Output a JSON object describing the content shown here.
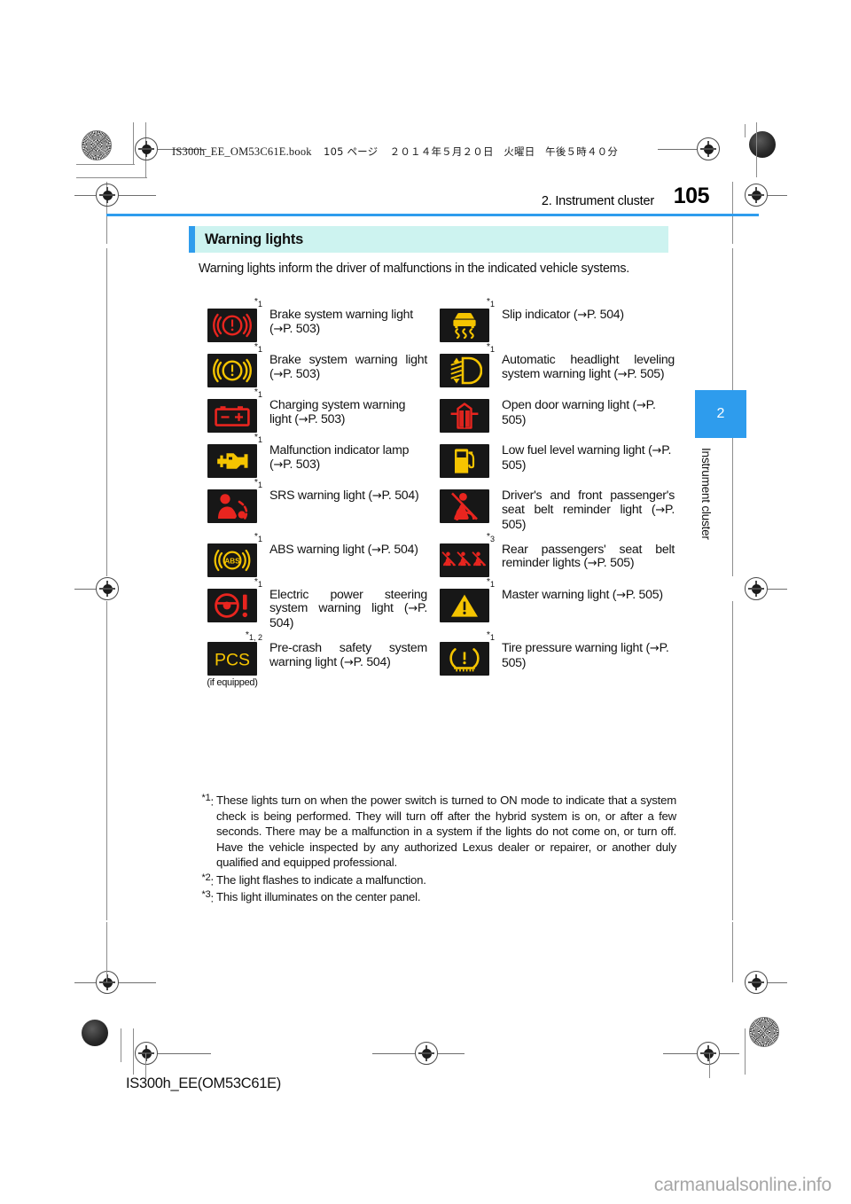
{
  "print_header": {
    "file_line": "IS300h_EE_OM53C61E.book",
    "page_marker": "105 ページ",
    "datetime": "２０１４年５月２０日　火曜日　午後５時４０分"
  },
  "running_head": {
    "chapter_label": "2. Instrument cluster",
    "page_number": "105"
  },
  "section": {
    "heading": "Warning lights",
    "intro": "Warning lights inform the driver of malfunctions in the indicated vehicle systems."
  },
  "thumb_tab": {
    "number": "2",
    "label": "Instrument cluster"
  },
  "table": {
    "rows": [
      {
        "left": {
          "footnote": "*1",
          "icon": "brake-system-warning-red-icon",
          "text": "Brake system warning light (→P. 503)",
          "justify": false
        },
        "right": {
          "footnote": "*1",
          "icon": "slip-indicator-icon",
          "text": "Slip indicator (→P. 504)",
          "justify": false
        }
      },
      {
        "left": {
          "footnote": "*1",
          "icon": "brake-system-warning-yellow-icon",
          "text": "Brake system warning light (→P. 503)",
          "justify": true
        },
        "right": {
          "footnote": "*1",
          "icon": "automatic-headlight-leveling-icon",
          "text": "Automatic headlight leveling system warning light (→P. 505)",
          "justify": true
        }
      },
      {
        "left": {
          "footnote": "*1",
          "icon": "charging-system-battery-icon",
          "text": "Charging system warning light (→P. 503)",
          "justify": false
        },
        "right": {
          "footnote": "",
          "icon": "open-door-warning-icon",
          "text": "Open door warning light (→P. 505)",
          "justify": false
        }
      },
      {
        "left": {
          "footnote": "*1",
          "icon": "malfunction-indicator-engine-icon",
          "text": "Malfunction indicator lamp (→P. 503)",
          "justify": false
        },
        "right": {
          "footnote": "",
          "icon": "low-fuel-level-icon",
          "text": "Low fuel level warning light (→P. 505)",
          "justify": false
        }
      },
      {
        "left": {
          "footnote": "*1",
          "icon": "srs-airbag-warning-icon",
          "text": "SRS warning light (→P. 504)",
          "justify": false
        },
        "right": {
          "footnote": "",
          "icon": "front-seat-belt-reminder-icon",
          "text": "Driver's and front passenger's seat belt reminder light (→P. 505)",
          "justify": true
        }
      },
      {
        "left": {
          "footnote": "*1",
          "icon": "abs-warning-icon",
          "text": "ABS warning light (→P. 504)",
          "justify": false
        },
        "right": {
          "footnote": "*3",
          "icon": "rear-seat-belt-reminder-icon",
          "text": "Rear passengers' seat belt reminder lights (→P. 505)",
          "justify": true
        }
      },
      {
        "left": {
          "footnote": "*1",
          "icon": "electric-power-steering-icon",
          "text": "Electric power steering system warning light (→P. 504)",
          "justify": true
        },
        "right": {
          "footnote": "*1",
          "icon": "master-warning-triangle-icon",
          "text": "Master warning light (→P. 505)",
          "justify": false
        }
      },
      {
        "left": {
          "footnote": "*1, 2",
          "icon": "pre-crash-safety-pcs-icon",
          "caption": "(if equipped)",
          "text": "Pre-crash safety system warning light (→P. 504)",
          "justify": true
        },
        "right": {
          "footnote": "*1",
          "icon": "tire-pressure-warning-icon",
          "text": "Tire pressure warning light (→P. 505)",
          "justify": false
        }
      }
    ]
  },
  "footnotes": [
    {
      "marker": "*1",
      "text": "These lights turn on when the power switch is turned to ON mode to indicate that a system check is being performed. They will turn off after the hybrid system is on, or after a few seconds. There may be a malfunction in a system if the lights do not come on, or turn off. Have the vehicle inspected by any authorized Lexus dealer or repairer, or another duly qualified and equipped professional."
    },
    {
      "marker": "*2",
      "text": "The light flashes to indicate a malfunction."
    },
    {
      "marker": "*3",
      "text": "This light illuminates on the center panel."
    }
  ],
  "bottom_code": "IS300h_EE(OM53C61E)",
  "watermark": "carmanualsonline.info",
  "colors": {
    "accent_blue": "#2e9ced",
    "heading_band": "#cdf3f0",
    "lamp_bg": "#171717",
    "lamp_red": "#e8251f",
    "lamp_yellow": "#f5c400"
  }
}
